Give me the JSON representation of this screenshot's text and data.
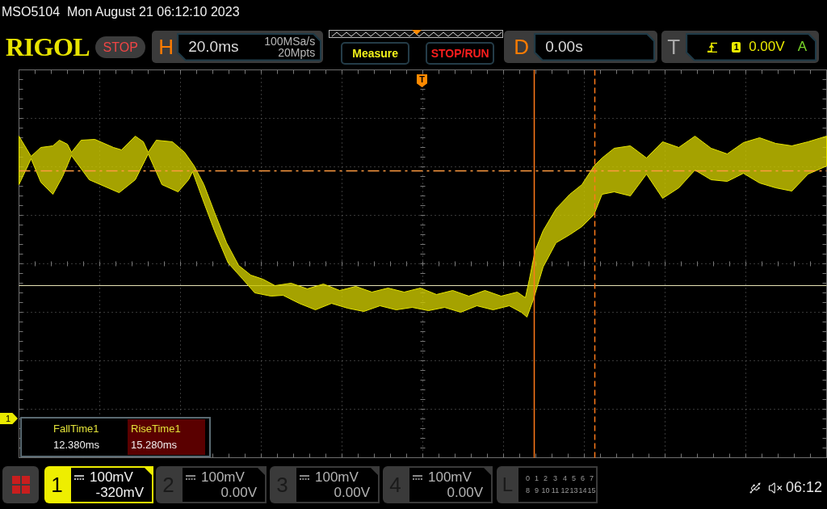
{
  "status_line": {
    "model": "MSO5104",
    "datetime": "Mon August 21 06:12:10 2023"
  },
  "header": {
    "logo": "RIGOL",
    "run_state": "STOP",
    "horizontal": {
      "label": "H",
      "timebase": "20.0ms",
      "sample_rate": "100MSa/s",
      "memory_depth": "20Mpts"
    },
    "buttons": [
      {
        "label": "Measure",
        "kind": "measure"
      },
      {
        "label": "STOP/RUN",
        "kind": "run_stop"
      }
    ],
    "delay": {
      "label": "D",
      "value": "0.00s"
    },
    "trigger": {
      "label": "T",
      "source": "1",
      "level": "0.00V",
      "sweep": "A"
    }
  },
  "plot": {
    "trigger_marker": "T",
    "channel_marker": "1",
    "measurements": [
      {
        "name": "FallTime1",
        "value": "12.380ms",
        "selected": false
      },
      {
        "name": "RiseTime1",
        "value": "15.280ms",
        "selected": true
      }
    ]
  },
  "channels": [
    {
      "number": "1",
      "scale": "100mV",
      "offset": "-320mV",
      "on": true
    },
    {
      "number": "2",
      "scale": "100mV",
      "offset": "0.00V",
      "on": false
    },
    {
      "number": "3",
      "scale": "100mV",
      "offset": "0.00V",
      "on": false
    },
    {
      "number": "4",
      "scale": "100mV",
      "offset": "0.00V",
      "on": false
    }
  ],
  "logic": {
    "label": "L",
    "rows": [
      [
        "0",
        "1",
        "2",
        "3",
        "4",
        "5",
        "6",
        "7"
      ],
      [
        "8",
        "9",
        "10",
        "11",
        "12",
        "13",
        "14",
        "15"
      ]
    ]
  },
  "status_bar": {
    "time": "06:12"
  }
}
